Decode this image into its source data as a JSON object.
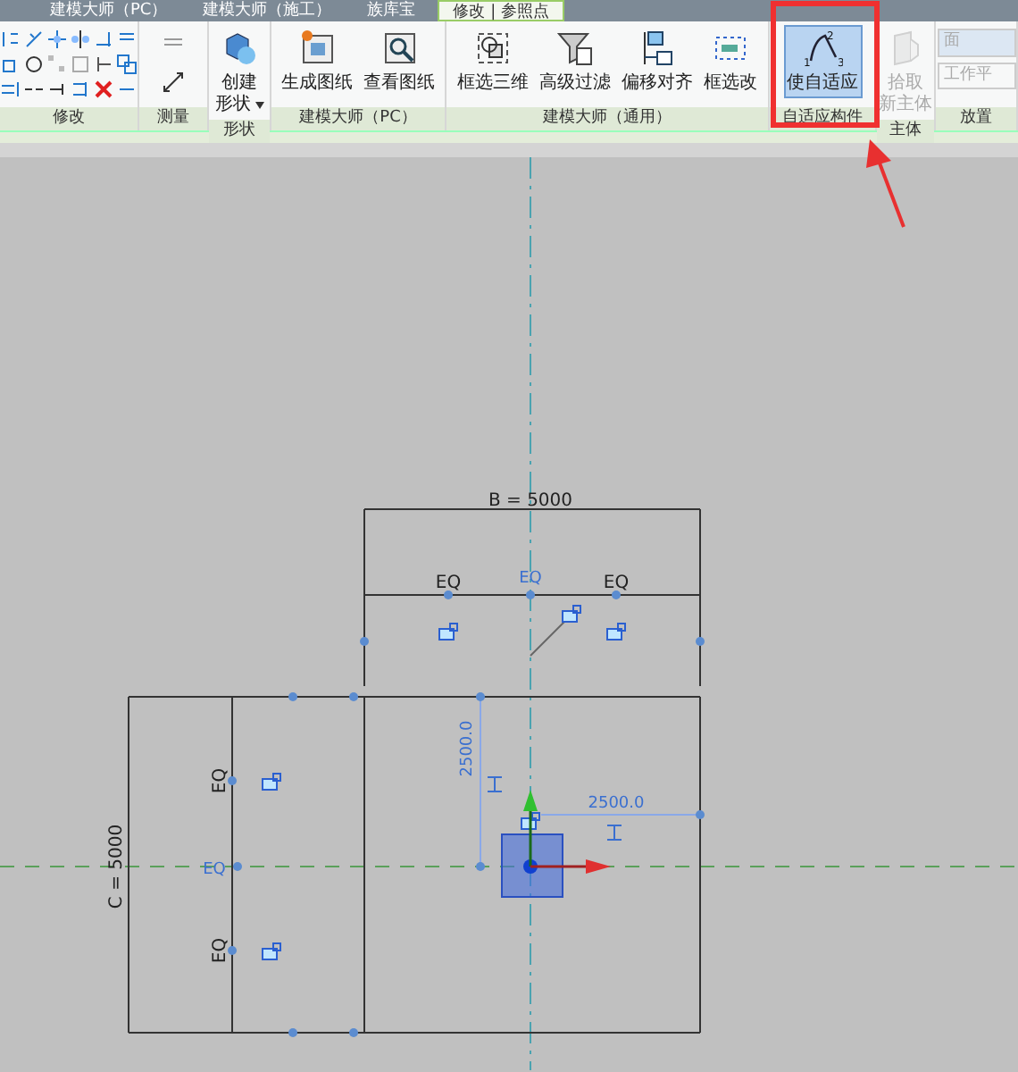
{
  "tabs": [
    {
      "label": "建模大师（PC）",
      "selected": false
    },
    {
      "label": "建模大师（施工）",
      "selected": false
    },
    {
      "label": "族库宝",
      "selected": false
    },
    {
      "label": "修改 | 参照点",
      "selected": true
    }
  ],
  "panels": [
    {
      "title": "修改",
      "kind": "tools"
    },
    {
      "title": "测量",
      "kind": "measure"
    },
    {
      "title": "形状",
      "kind": "buttons",
      "buttons": [
        {
          "label": "创建",
          "label2": "形状",
          "dropdown": true,
          "selected": false,
          "disabled": false
        }
      ]
    },
    {
      "title": "建模大师（PC）",
      "kind": "buttons",
      "buttons": [
        {
          "label": "生成图纸",
          "selected": false,
          "disabled": false
        },
        {
          "label": "查看图纸",
          "selected": false,
          "disabled": false
        }
      ]
    },
    {
      "title": "建模大师（通用）",
      "kind": "buttons",
      "buttons": [
        {
          "label": "框选三维",
          "selected": false,
          "disabled": false
        },
        {
          "label": "高级过滤",
          "selected": false,
          "disabled": false
        },
        {
          "label": "偏移对齐",
          "selected": false,
          "disabled": false
        },
        {
          "label": "框选改",
          "selected": false,
          "disabled": false
        }
      ]
    },
    {
      "title": "自适应构件",
      "kind": "buttons",
      "buttons": [
        {
          "label": "使自适应",
          "icon_numbers": [
            "2",
            "1",
            "3"
          ],
          "selected": true,
          "disabled": false
        }
      ]
    },
    {
      "title": "主体",
      "kind": "buttons",
      "buttons": [
        {
          "label": "拾取",
          "label2": "新主体",
          "selected": false,
          "disabled": true
        }
      ]
    },
    {
      "title": "放置",
      "kind": "place",
      "items": [
        {
          "label": "面",
          "selected": true,
          "disabled": true
        },
        {
          "label": "工作平",
          "selected": false,
          "disabled": true
        }
      ]
    }
  ],
  "canvas": {
    "labels": [
      {
        "text": "B = 5000",
        "kind": "dim"
      },
      {
        "text": "EQ",
        "kind": "dim"
      },
      {
        "text": "EQ",
        "kind": "active"
      },
      {
        "text": "EQ",
        "kind": "dim"
      },
      {
        "text": "C = 5000",
        "kind": "dim"
      },
      {
        "text": "EQ",
        "kind": "dim"
      },
      {
        "text": "EQ",
        "kind": "active"
      },
      {
        "text": "EQ",
        "kind": "dim"
      },
      {
        "text": "2500.0",
        "kind": "active"
      },
      {
        "text": "2500.0",
        "kind": "active"
      }
    ]
  }
}
